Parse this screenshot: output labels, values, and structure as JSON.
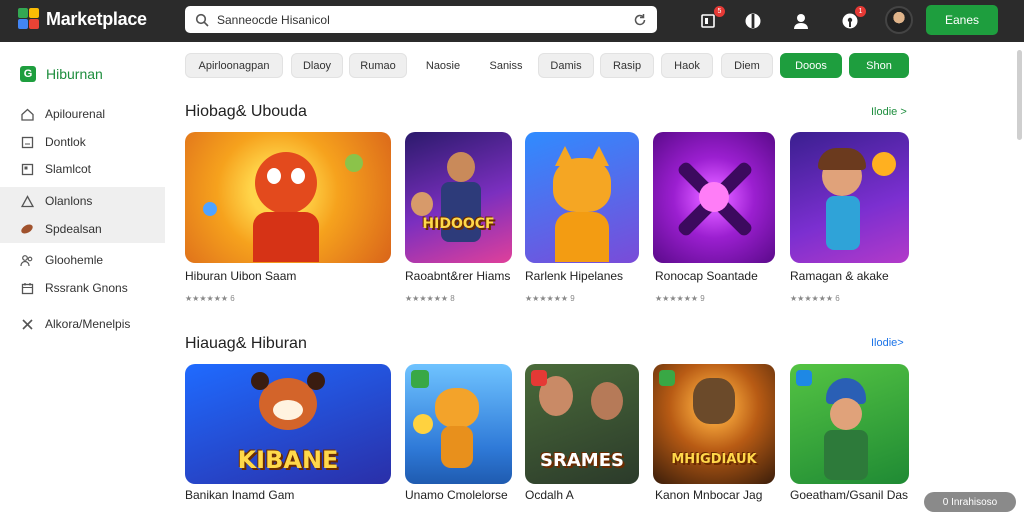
{
  "brand": {
    "title": "Marketplace"
  },
  "search": {
    "value": "Sanneocde Hisanicol"
  },
  "header_button": {
    "label": "Eanes"
  },
  "notifications": {
    "count_a": "5",
    "count_b": "1"
  },
  "sidebar": {
    "heading": "Hiburnan",
    "items": [
      {
        "label": "Apilourenal",
        "icon": "home-icon"
      },
      {
        "label": "Dontlok",
        "icon": "document-icon"
      },
      {
        "label": "Slamlcot",
        "icon": "square-icon"
      },
      {
        "label": "Olanlons",
        "icon": "triangle-icon"
      },
      {
        "label": "Spdealsan",
        "icon": "football-icon"
      },
      {
        "label": "Gloohemle",
        "icon": "people-icon"
      },
      {
        "label": "Rssrank Gnons",
        "icon": "calendar-icon"
      },
      {
        "label": "Alkora/Menelpis",
        "icon": "tools-icon"
      }
    ]
  },
  "chips": [
    "Apirloonagpan",
    "Dlaoy",
    "Rumao",
    "Naosie",
    "Saniss",
    "Damis",
    "Rasip",
    "Haok",
    "Diem",
    "Dooos",
    "Shon"
  ],
  "sections": [
    {
      "title": "Hiobag& Ubouda",
      "more": "Ilodie >",
      "cards": [
        {
          "name": "Hiburan Uibon Saam",
          "sub": "★★★★★★ 6",
          "art": ""
        },
        {
          "name": "Raoabnt&rer Hiams",
          "sub": "★★★★★★ 8",
          "art": "HIDOOCF"
        },
        {
          "name": "Rarlenk Hipelanes",
          "sub": "★★★★★★ 9",
          "art": ""
        },
        {
          "name": "Ronocap Soantade",
          "sub": "★★★★★★ 9",
          "art": ""
        },
        {
          "name": "Ramagan & akake",
          "sub": "★★★★★★ 6",
          "art": ""
        }
      ]
    },
    {
      "title": "Hiauag& Hiburan",
      "more": "Ilodie>",
      "cards": [
        {
          "name": "Banikan Inamd Gam",
          "sub": "",
          "art": "KIBANE"
        },
        {
          "name": "Unamo Cmolelorse",
          "sub": "",
          "art": ""
        },
        {
          "name": "Ocdalh A",
          "sub": "",
          "art": "SRAMES"
        },
        {
          "name": "Kanon Mnbocar Jag",
          "sub": "",
          "art": "MHIGDIAUK"
        },
        {
          "name": "Goeatham/Gsanil Das",
          "sub": "",
          "art": ""
        }
      ]
    }
  ],
  "footer": {
    "label": "0 Inrahisoso"
  },
  "colors": {
    "accent": "#1e9e3e",
    "topbar": "#2b2b2b"
  }
}
